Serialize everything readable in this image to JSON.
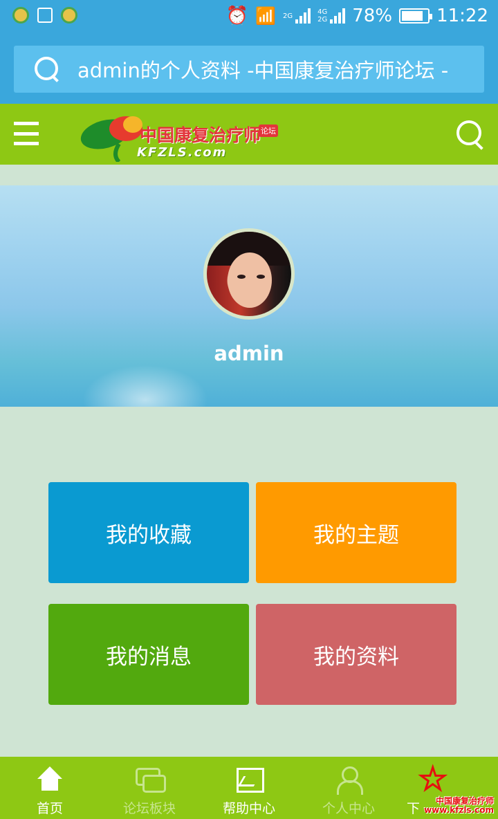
{
  "statusbar": {
    "battery": "78%",
    "time": "11:22",
    "network_top": "2G",
    "network_4g": "4G",
    "network_2g": "2G"
  },
  "addressbar": {
    "text": "admin的个人资料 -中国康复治疗师论坛 -"
  },
  "header": {
    "logo_text": "中国康复治疗师",
    "logo_tag": "论坛",
    "logo_sub": "KFZLS.com"
  },
  "profile": {
    "username": "admin"
  },
  "tiles": {
    "favorites": "我的收藏",
    "topics": "我的主题",
    "messages": "我的消息",
    "profile": "我的资料"
  },
  "bottomnav": {
    "items": [
      {
        "label": "首页"
      },
      {
        "label": "论坛板块"
      },
      {
        "label": "帮助中心"
      },
      {
        "label": "个人中心"
      },
      {
        "label": "下"
      }
    ],
    "watermark_line1": "中国康复治疗师",
    "watermark_line2": "www.kfzls.com"
  },
  "colors": {
    "statusbar": "#3aa7dc",
    "header": "#8ec814",
    "tile_favorites": "#0a9ad1",
    "tile_topics": "#ff9a00",
    "tile_messages": "#52a90e",
    "tile_profile": "#cf6466"
  }
}
